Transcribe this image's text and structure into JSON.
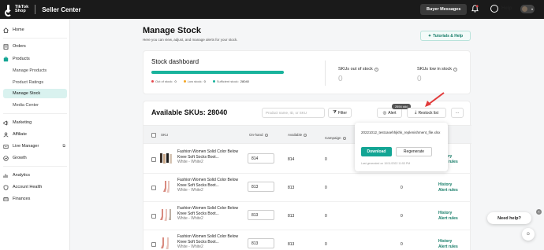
{
  "header": {
    "logo_line1": "TikTok",
    "logo_line2": "Shop",
    "title": "Seller Center",
    "buyer_messages": "Buyer Messages",
    "help": "Help"
  },
  "sidebar": {
    "items": [
      {
        "label": "Home",
        "icon": "home-icon"
      },
      {
        "label": "Orders",
        "icon": "orders-icon"
      },
      {
        "label": "Products",
        "icon": "products-icon"
      },
      {
        "label": "Manage Products"
      },
      {
        "label": "Product Ratings"
      },
      {
        "label": "Manage Stock"
      },
      {
        "label": "Media Center"
      },
      {
        "label": "Marketing",
        "icon": "marketing-icon"
      },
      {
        "label": "Affiliate",
        "icon": "affiliate-icon"
      },
      {
        "label": "Live Manager",
        "icon": "live-icon"
      },
      {
        "label": "Growth",
        "icon": "growth-icon"
      },
      {
        "label": "Analytics",
        "icon": "analytics-icon"
      },
      {
        "label": "Account Health",
        "icon": "account-health-icon"
      },
      {
        "label": "Finances",
        "icon": "finances-icon"
      }
    ]
  },
  "page": {
    "title": "Manage Stock",
    "subtitle": "Here you can view, adjust, and manage alerts for your stock.",
    "tutorials": "Tutorials & Help"
  },
  "dashboard": {
    "title": "Stock dashboard",
    "legend": [
      {
        "label": "Out of stock:",
        "value": "0",
        "color": "#e5484d"
      },
      {
        "label": "Low stock:",
        "value": "0",
        "color": "#f5a623"
      },
      {
        "label": "Sufficient stock:",
        "value": "28040",
        "color": "#19b39c"
      }
    ],
    "skus_out_label": "SKUs out of stock",
    "skus_out_value": "0",
    "skus_low_label": "SKUs low in stock",
    "skus_low_value": "0"
  },
  "table": {
    "title": "Available SKUs: 28040",
    "search_placeholder": "Product name, ID, or SKU",
    "filter": "Filter",
    "alert": "Alert",
    "restock": "Restock list",
    "tag": "28/04 ddd",
    "more": "···",
    "columns": {
      "sku": "SKU",
      "on_hand": "On-hand",
      "available": "Available",
      "campaign": "Campaign"
    },
    "rows": [
      {
        "name": "Fashion Women Solid Color Below Knee Soft Socks Boot...",
        "variant": "White - White2",
        "on_hand": "814",
        "available": "814",
        "campaign": "0",
        "links": [
          "History",
          "Alert rules"
        ]
      },
      {
        "name": "Fashion Women Solid Color Below Knee Soft Socks Boot...",
        "variant": "White - White2",
        "on_hand": "813",
        "available": "813",
        "campaign": "0",
        "links": [
          "History",
          "Alert rules"
        ]
      },
      {
        "name": "Fashion Women Solid Color Below Knee Soft Socks Boot...",
        "variant": "White - White2",
        "on_hand": "813",
        "available": "813",
        "campaign": "0",
        "links": [
          "History",
          "Alert rules"
        ]
      },
      {
        "name": "Fashion Women Solid Color Below Knee Soft Socks Boot...",
        "variant": "White - White2",
        "on_hand": "813",
        "available": "813",
        "campaign": "0",
        "links": [
          "History",
          "Alert rules"
        ]
      }
    ]
  },
  "popover": {
    "filename": "20221012_testcasehhjkhk_replenishment_file.xlsx",
    "download": "Download",
    "regenerate": "Regenerate",
    "generated": "Last generated on 10/11/2022 11:53 PM"
  },
  "float": {
    "need_help": "Need help?"
  },
  "colors": {
    "accent": "#13a594",
    "header_bg": "#1a1a1a",
    "active_nav": "#d9f2ef",
    "arrow": "#e23b3b"
  }
}
